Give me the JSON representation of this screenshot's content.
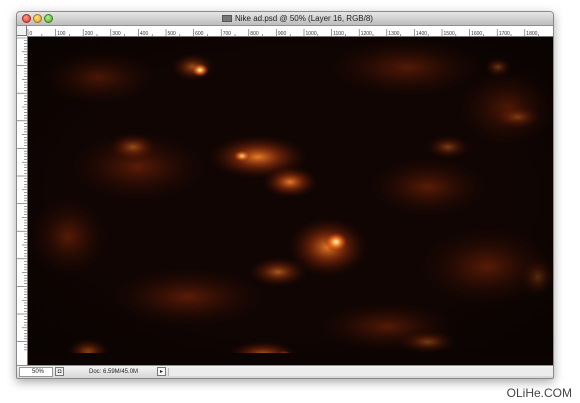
{
  "window": {
    "title": "Nike ad.psd @ 50% (Layer 16, RGB/8)"
  },
  "ruler": {
    "h_labels": [
      "0",
      "100",
      "200",
      "300",
      "400",
      "500",
      "600",
      "700",
      "800",
      "900",
      "1000",
      "1100",
      "1200",
      "1300",
      "1400",
      "1500",
      "1600",
      "1700",
      "1800"
    ]
  },
  "status": {
    "zoom": "50%",
    "doc_info": "Doc: 6.59M/45.0M",
    "arrow": "▸"
  },
  "watermark": "OLiHe.COM",
  "colors": {
    "canvas_bg": "#0b0402",
    "glow": "#ff6a1a"
  }
}
